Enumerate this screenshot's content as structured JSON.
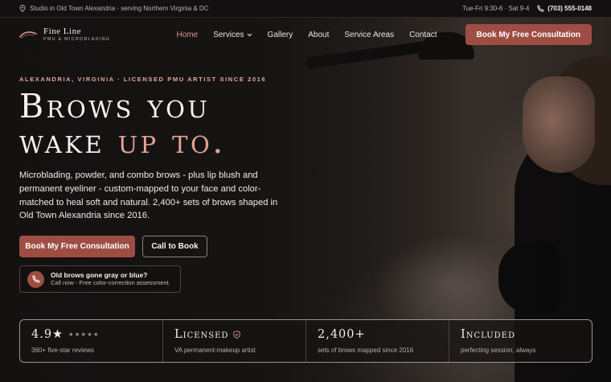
{
  "topbar": {
    "location": "Studio in Old Town Alexandria · serving Northern Virginia & DC",
    "hours": "Tue-Fri 9:30-6 · Sat 9-4",
    "phone": "(703) 555-0148"
  },
  "brand": {
    "name": "Fine Line",
    "tagline": "PMU & MICROBLADING"
  },
  "nav": {
    "items": [
      {
        "label": "Home"
      },
      {
        "label": "Services"
      },
      {
        "label": "Gallery"
      },
      {
        "label": "About"
      },
      {
        "label": "Service Areas"
      },
      {
        "label": "Contact"
      }
    ],
    "cta": "Book My Free Consultation"
  },
  "hero": {
    "eyebrow": "ALEXANDRIA, VIRGINIA · LICENSED PMU ARTIST SINCE 2016",
    "headline_line1": "Brows you",
    "headline_line2_part1": "wake ",
    "headline_line2_accent": "up to.",
    "lead": "Microblading, powder, and combo brows - plus lip blush and permanent eyeliner - custom-mapped to your face and color-matched to heal soft and natural. 2,400+ sets of brows shaped in Old Town Alexandria since 2016.",
    "primary_button": "Book My Free Consultation",
    "secondary_button": "Call to Book",
    "callout_title": "Old brows gone gray or blue?",
    "callout_sub": "Call now - Free color-correction assessment."
  },
  "stats": [
    {
      "value": "4.9★",
      "stars": "★★★★★",
      "label": "360+ five-star reviews"
    },
    {
      "value": "Licensed",
      "label": "VA permanent-makeup artist"
    },
    {
      "value": "2,400+",
      "label": "sets of brows mapped since 2016"
    },
    {
      "value": "Included",
      "label": "perfecting session, always"
    }
  ],
  "colors": {
    "accent": "#9e4d43",
    "accent_text": "#e3a396",
    "nav_active": "#d9968a"
  }
}
